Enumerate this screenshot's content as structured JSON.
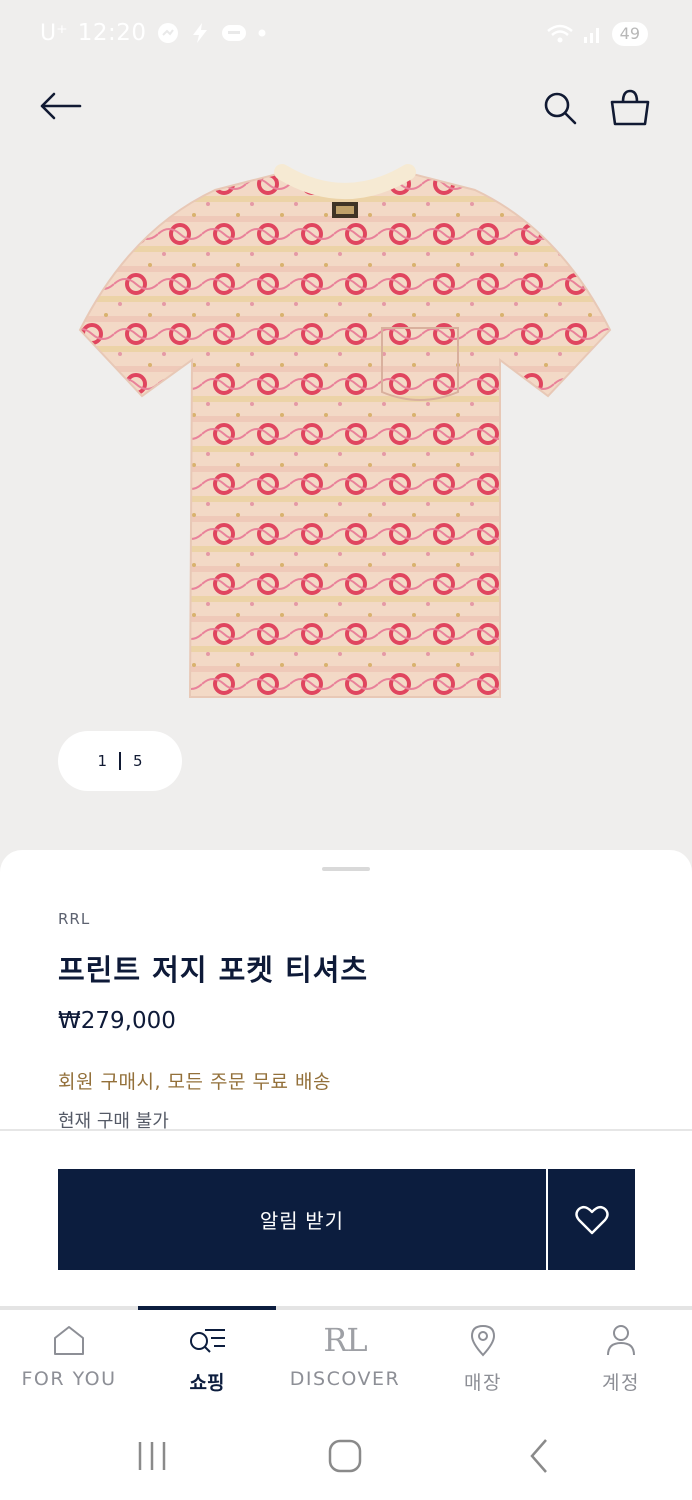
{
  "status": {
    "carrier": "U⁺",
    "time": "12:20",
    "battery": "49"
  },
  "product": {
    "brand": "RRL",
    "name": "프린트 저지 포켓 티셔츠",
    "price": "₩279,000",
    "promo": "회원 구매시, 모든 주문 무료 배송",
    "availability": "현재 구매 불가",
    "image_pager": {
      "current": "1",
      "total": "5"
    }
  },
  "actions": {
    "notify_label": "알림 받기",
    "wishlist_icon": "heart-icon"
  },
  "colors": {
    "navy": "#0c1d3e",
    "promo": "#93703a",
    "background": "#efeeed"
  },
  "tab_bar": {
    "items": [
      {
        "label": "FOR YOU",
        "icon": "home-icon",
        "active": false
      },
      {
        "label": "쇼핑",
        "icon": "shopping-search-icon",
        "active": true
      },
      {
        "label": "DISCOVER",
        "icon": "rl-logo",
        "logo_text": "RL",
        "active": false
      },
      {
        "label": "매장",
        "icon": "location-pin-icon",
        "active": false
      },
      {
        "label": "계정",
        "icon": "person-icon",
        "active": false
      }
    ]
  }
}
